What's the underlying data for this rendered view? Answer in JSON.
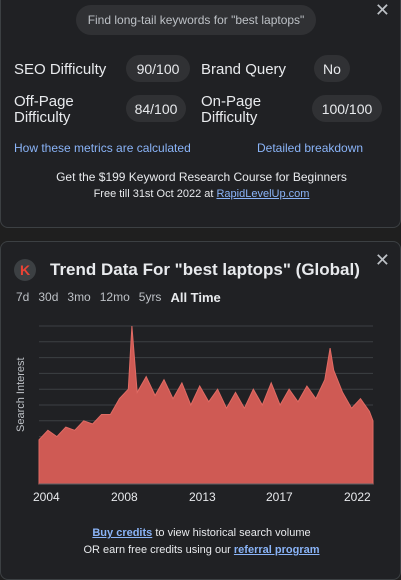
{
  "search": {
    "placeholder": "Find long-tail keywords for \"best laptops\""
  },
  "metrics": {
    "seo_difficulty_label": "SEO Difficulty",
    "seo_difficulty_value": "90/100",
    "brand_query_label": "Brand Query",
    "brand_query_value": "No",
    "off_page_label_1": "Off-Page",
    "off_page_label_2": "Difficulty",
    "off_page_value": "84/100",
    "on_page_label_1": "On-Page",
    "on_page_label_2": "Difficulty",
    "on_page_value": "100/100"
  },
  "links": {
    "how_calculated": "How these metrics are calculated",
    "breakdown": "Detailed breakdown"
  },
  "promo": {
    "line1": "Get the $199 Keyword Research Course for Beginners",
    "line2_prefix": "Free till 31st Oct 2022 at ",
    "line2_link": "RapidLevelUp.com"
  },
  "trend": {
    "logo_letter": "K",
    "title": "Trend Data For \"best laptops\" (Global)",
    "ranges": [
      "7d",
      "30d",
      "3mo",
      "12mo",
      "5yrs",
      "All Time"
    ],
    "active_range": "All Time"
  },
  "footer": {
    "link1": "Buy credits",
    "text1": " to view historical search volume",
    "text2": "OR earn free credits using our ",
    "link2": "referral program"
  },
  "icons": {
    "close": "close-icon",
    "logo": "keywords-everywhere-logo-icon"
  },
  "colors": {
    "area_fill": "#cf5a54",
    "link": "#8ab4f8",
    "logo_bg": "#3c4043",
    "logo_letter": "#ea4335"
  },
  "chart_data": {
    "type": "area",
    "title": "",
    "xlabel": "",
    "ylabel": "Search Interest",
    "x_ticks": [
      "2004",
      "2008",
      "2013",
      "2017",
      "2022"
    ],
    "x": [
      2004.0,
      2004.5,
      2005.0,
      2005.5,
      2006.0,
      2006.5,
      2007.0,
      2007.5,
      2008.0,
      2008.5,
      2009.0,
      2009.2,
      2009.5,
      2010.0,
      2010.5,
      2011.0,
      2011.5,
      2012.0,
      2012.5,
      2013.0,
      2013.5,
      2014.0,
      2014.5,
      2015.0,
      2015.5,
      2016.0,
      2016.5,
      2017.0,
      2017.5,
      2018.0,
      2018.5,
      2019.0,
      2019.5,
      2020.0,
      2020.3,
      2020.5,
      2021.0,
      2021.5,
      2022.0,
      2022.5,
      2022.7
    ],
    "y": [
      28,
      34,
      30,
      36,
      34,
      40,
      38,
      44,
      44,
      54,
      60,
      100,
      58,
      68,
      56,
      66,
      54,
      64,
      50,
      62,
      52,
      60,
      48,
      58,
      48,
      60,
      50,
      64,
      50,
      60,
      52,
      62,
      54,
      66,
      86,
      72,
      58,
      48,
      54,
      46,
      40
    ],
    "ylim": [
      0,
      100
    ],
    "grid": true
  }
}
